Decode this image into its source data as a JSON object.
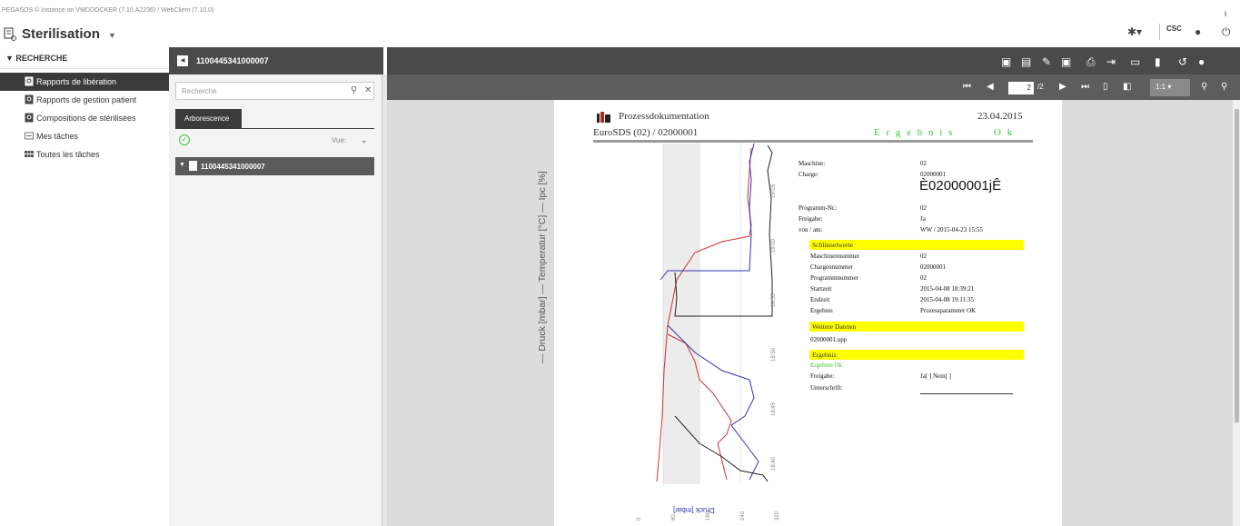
{
  "app": {
    "instance_text": "PEGASOS © Instance on VMDDOCKER (7.10.A2236) / WebClient (7.10.0)",
    "title": "Sterilisation",
    "user": "CSC",
    "info": "i"
  },
  "nav": {
    "section": "RECHERCHE",
    "items": [
      {
        "label": "Rapports de libération",
        "active": true
      },
      {
        "label": "Rapports de gestion patient"
      },
      {
        "label": "Compositions de stérilisées"
      },
      {
        "label": "Mes tâches"
      },
      {
        "label": "Toutes les tâches"
      }
    ]
  },
  "middle": {
    "record_id": "1100445341000007",
    "search_placeholder": "Recherche",
    "tab": "Arborescence",
    "view_label": "Vue:",
    "tree_item": "1100445341000007"
  },
  "viewer": {
    "page_current": "2",
    "page_total": "/2",
    "ratio": "1:1"
  },
  "document": {
    "header_title": "Prozessdokumentation",
    "header_date": "23.04.2015",
    "sub_title": "EuroSDS (02) / 02000001",
    "result_banner": "E r g e b n i s",
    "result_ok": "O k",
    "info": [
      {
        "k": "Maschine:",
        "v": "02"
      },
      {
        "k": "Charge:",
        "v": "02000001"
      }
    ],
    "barcode_text": "È02000001jÊ",
    "info2": [
      {
        "k": "Programm-Nr.:",
        "v": "02"
      },
      {
        "k": "Freigabe:",
        "v": "Ja"
      },
      {
        "k": "von / am:",
        "v": "WW / 2015-04-23 15:55"
      }
    ],
    "section_keys": "Schlüsselwerte",
    "keys": [
      {
        "k": "Maschinennummer",
        "v": "02"
      },
      {
        "k": "Chargennummer",
        "v": "02000001"
      },
      {
        "k": "Programmnummer",
        "v": "02"
      },
      {
        "k": "Startzeit",
        "v": "2015-04-08 18:39:21"
      },
      {
        "k": "Endzeit",
        "v": "2015-04-08 19:11:35"
      },
      {
        "k": "Ergebnis",
        "v": "Prozessparameter OK"
      }
    ],
    "section_files": "Weitere Dateien",
    "file": "02000001.upp",
    "section_result": "Ergebnis",
    "result_line": "Ergebnis Ok",
    "release_label": "Freigabe:",
    "release_value": "Ja[ ] Nein[ ]",
    "signature_label": "Unterschrift:",
    "chart_axis_label": "— Druck [mbar] — Temperatur [°C] — Ipc [%]",
    "chart_bottom_label": "Druck [mbar]",
    "time_ticks": [
      "18:40",
      "18:45",
      "18:50",
      "18:55",
      "19:00",
      "19:05",
      "19:10"
    ],
    "pressure_ticks": [
      "0",
      "80",
      "160",
      "240",
      "320"
    ]
  },
  "colors": {
    "dark_header": "#4a4a4a",
    "active_nav": "#3b3b3b",
    "highlight": "#ffff00",
    "ok_green": "#3cc43c"
  }
}
